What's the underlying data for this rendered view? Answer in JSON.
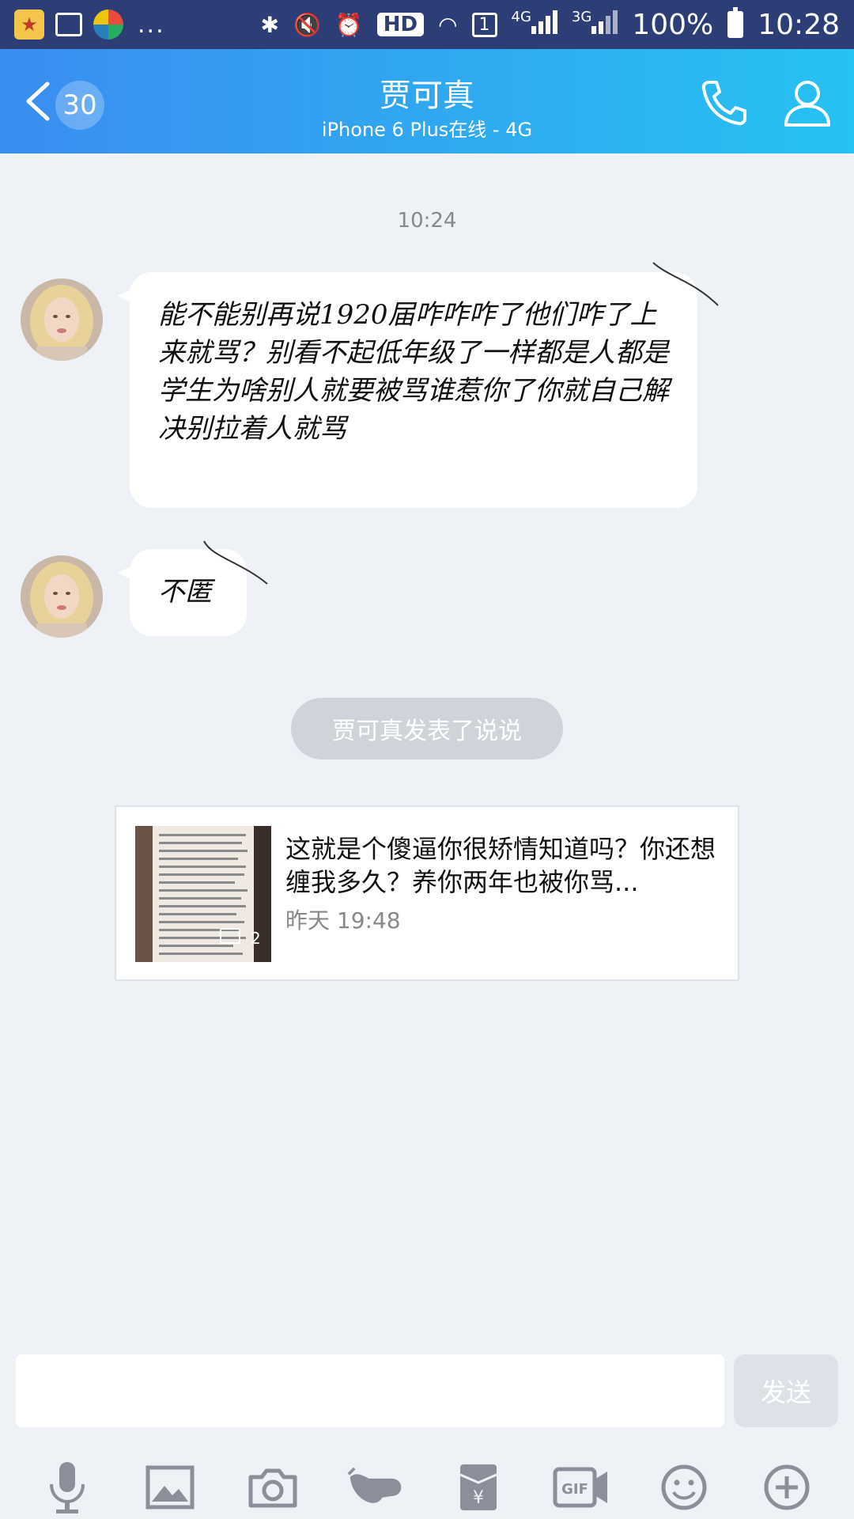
{
  "status_bar": {
    "time": "10:28",
    "battery": "100%",
    "hd": "HD",
    "sim": "1",
    "net_1": "4G",
    "net_2": "3G",
    "dots": "..."
  },
  "header": {
    "unread_count": "30",
    "contact_name": "贾可真",
    "status": "iPhone 6 Plus在线 - 4G"
  },
  "chat": {
    "timestamp": "10:24",
    "messages": [
      {
        "sender": "贾可真",
        "text": "能不能别再说1920届咋咋咋了他们咋了上来就骂？别看不起低年级了一样都是人都是学生为啥别人就要被骂谁惹你了你就自己解决别拉着人就骂"
      },
      {
        "sender": "贾可真",
        "text": "不匿"
      }
    ],
    "system_notice": "贾可真发表了说说",
    "post_card": {
      "text": "这就是个傻逼你很矫情知道吗？你还想缠我多久？养你两年也被你骂...",
      "time": "昨天 19:48",
      "image_count": "2"
    }
  },
  "input_bar": {
    "placeholder": "",
    "send_label": "发送"
  },
  "toolbar": {
    "icons": [
      "mic-icon",
      "image-icon",
      "camera-icon",
      "poke-icon",
      "red-packet-icon",
      "gif-icon",
      "emoji-icon",
      "plus-icon"
    ]
  },
  "colors": {
    "header_start": "#3a8df0",
    "header_end": "#26c2f2",
    "status_bar": "#2c3e75",
    "background": "#eef1f6"
  }
}
